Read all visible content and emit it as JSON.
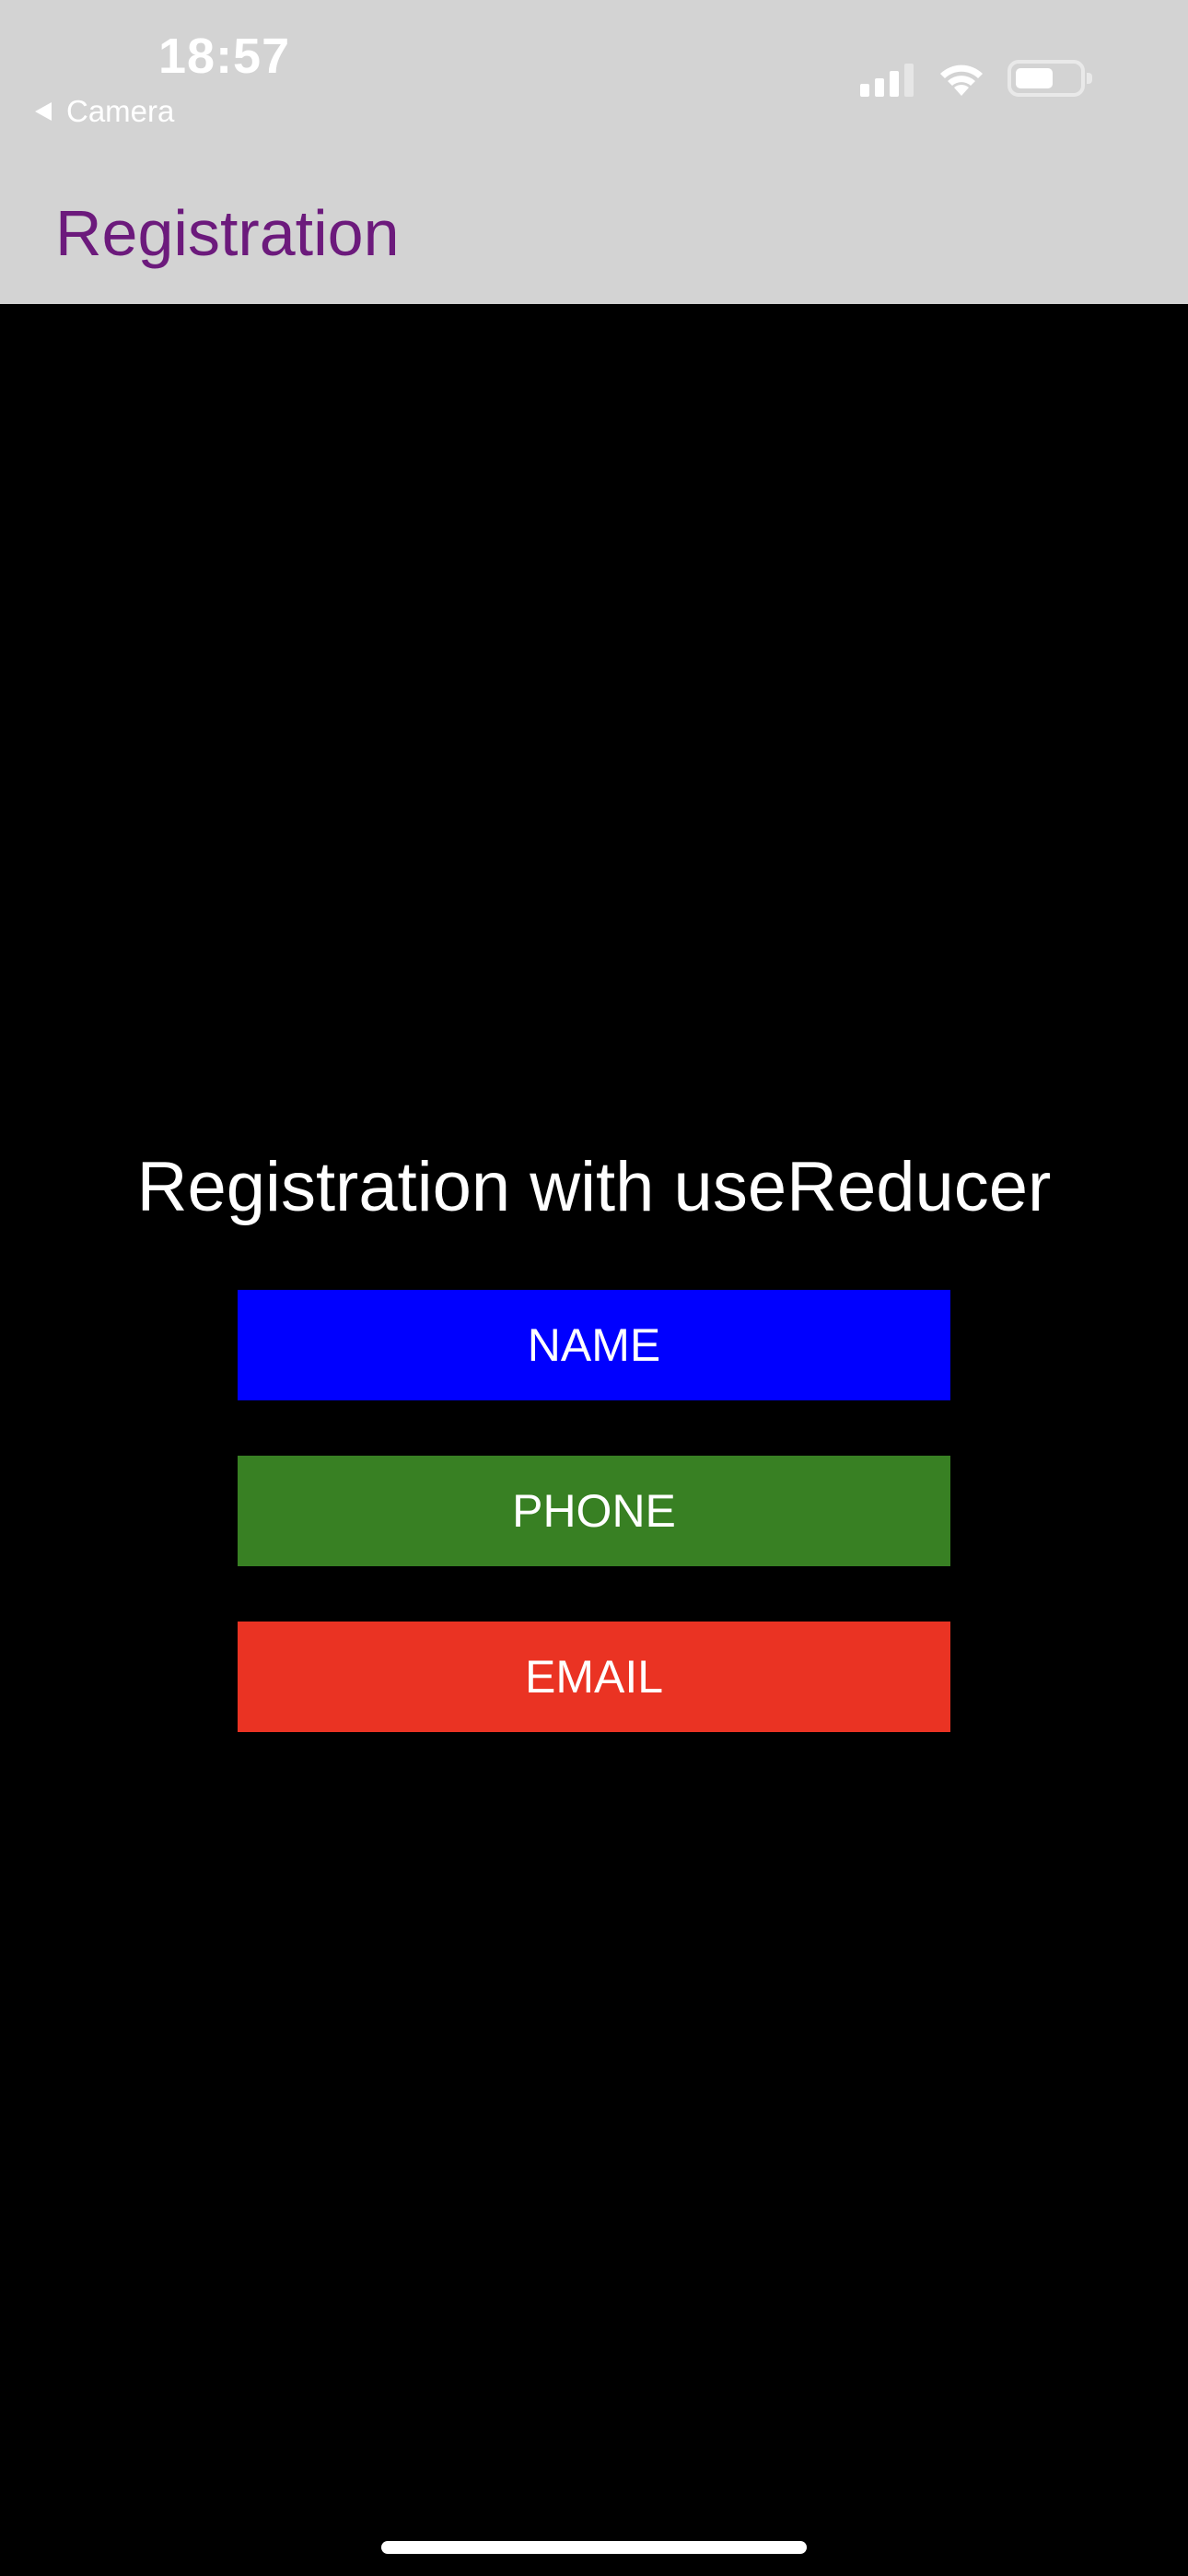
{
  "status_bar": {
    "time": "18:57",
    "back_label": "Camera",
    "signal_icon": "cellular-signal-icon",
    "wifi_icon": "wifi-icon",
    "battery_icon": "battery-icon",
    "battery_level": 0.5
  },
  "nav": {
    "title": "Registration",
    "title_color": "#6c1a7c",
    "background": "#d3d3d3"
  },
  "main": {
    "heading": "Registration with useReducer",
    "background": "#000000",
    "buttons": [
      {
        "label": "NAME",
        "color": "#0000ff"
      },
      {
        "label": "PHONE",
        "color": "#388023"
      },
      {
        "label": "EMAIL",
        "color": "#ea3323"
      }
    ]
  }
}
